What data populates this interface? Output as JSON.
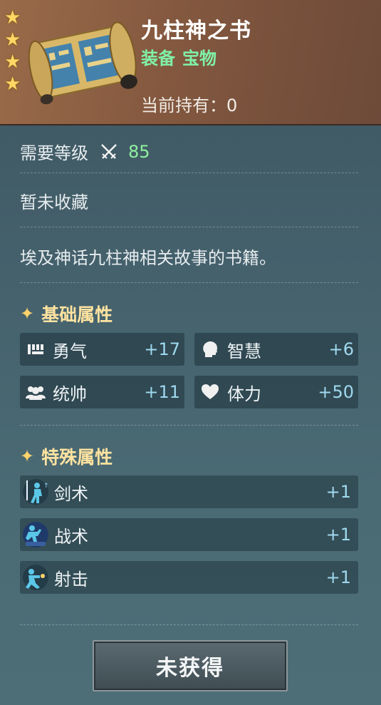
{
  "item": {
    "name": "九柱神之书",
    "type_tags": [
      "装备",
      "宝物"
    ],
    "owned_label": "当前持有：",
    "owned_value": "0",
    "stars": 4
  },
  "requirement": {
    "label": "需要等级",
    "level": "85",
    "icon": "crossed-swords-icon"
  },
  "collection_status": "暂未收藏",
  "description": "埃及神话九柱神相关故事的书籍。",
  "basic_attributes": {
    "title": "基础属性",
    "items": [
      {
        "label": "勇气",
        "value": "+17",
        "icon": "courage-icon"
      },
      {
        "label": "智慧",
        "value": "+6",
        "icon": "wisdom-icon"
      },
      {
        "label": "统帅",
        "value": "+11",
        "icon": "command-icon"
      },
      {
        "label": "体力",
        "value": "+50",
        "icon": "heart-icon"
      }
    ]
  },
  "special_attributes": {
    "title": "特殊属性",
    "items": [
      {
        "label": "剑术",
        "value": "+1",
        "icon": "swordsmanship-icon"
      },
      {
        "label": "战术",
        "value": "+1",
        "icon": "tactics-icon"
      },
      {
        "label": "射击",
        "value": "+1",
        "icon": "shooting-icon"
      }
    ]
  },
  "action_button": "未获得",
  "colors": {
    "header_bg": "#83583f",
    "type_green": "#7ff2a8",
    "level_green": "#8ff0a0",
    "section_gold": "#ffe3a0",
    "value_blue": "#9fd9ef"
  }
}
